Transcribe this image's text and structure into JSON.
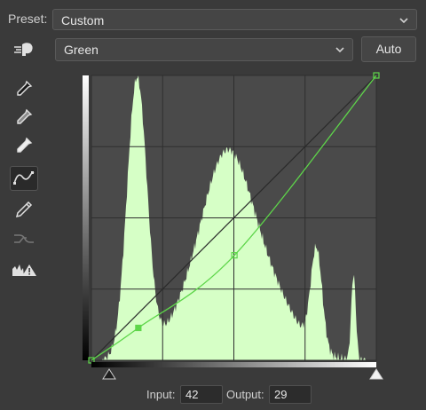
{
  "preset": {
    "label": "Preset:",
    "value": "Custom"
  },
  "channel": {
    "value": "Green"
  },
  "auto_button": {
    "label": "Auto"
  },
  "tools": [
    {
      "name": "targeted-adjustment-icon"
    },
    {
      "name": "black-point-eyedropper-icon"
    },
    {
      "name": "gray-point-eyedropper-icon"
    },
    {
      "name": "white-point-eyedropper-icon"
    },
    {
      "name": "curve-point-tool-icon",
      "active": true
    },
    {
      "name": "pencil-draw-icon"
    },
    {
      "name": "smooth-curve-icon",
      "disabled": true
    },
    {
      "name": "clipping-warning-icon"
    }
  ],
  "curve": {
    "channel_color": "#5ed64a",
    "histogram_color": "#d6ffc6",
    "points": [
      [
        0,
        0
      ],
      [
        42,
        29
      ],
      [
        128,
        94
      ],
      [
        255,
        255
      ]
    ]
  },
  "input": {
    "label": "Input:",
    "value": "42"
  },
  "output": {
    "label": "Output:",
    "value": "29"
  }
}
